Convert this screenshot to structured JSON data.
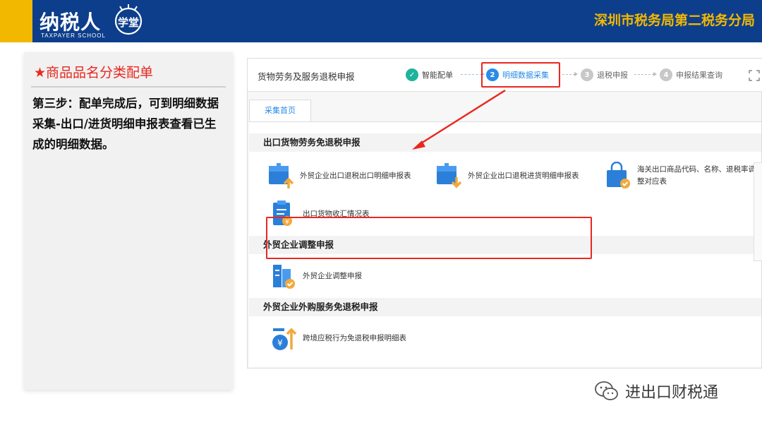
{
  "header": {
    "logo_text": "纳税人",
    "logo_subtitle": "TAXPAYER SCHOOL",
    "logo_emblem_text": "学堂",
    "office_name": "深圳市税务局第二税务分局",
    "colors": {
      "banner": "#0d3e8c",
      "accent": "#f2b800"
    }
  },
  "instruction": {
    "title": "★商品品名分类配单",
    "body": "第三步：配单完成后，可到明细数据采集-出口/进货明细申报表查看已生成的明细数据。",
    "title_color": "#e8281f"
  },
  "app": {
    "title": "货物劳务及服务退税申报",
    "steps": [
      {
        "num": "✓",
        "label": "智能配单",
        "state": "done"
      },
      {
        "num": "2",
        "label": "明细数据采集",
        "state": "active"
      },
      {
        "num": "3",
        "label": "退税申报",
        "state": "todo"
      },
      {
        "num": "4",
        "label": "申报结果查询",
        "state": "todo"
      }
    ],
    "fullscreen_icon": "fullscreen-icon",
    "tab_label": "采集首页",
    "sections": [
      {
        "title": "出口货物劳务免退税申报",
        "items": [
          {
            "label": "外贸企业出口退税出口明细申报表",
            "icon": "upload-box-icon"
          },
          {
            "label": "外贸企业出口退税进货明细申报表",
            "icon": "download-box-icon"
          },
          {
            "label": "海关出口商品代码、名称、退税率调整对应表",
            "icon": "shopping-bag-icon"
          },
          {
            "label": "出口货物收汇情况表",
            "icon": "clipboard-currency-icon"
          }
        ]
      },
      {
        "title": "外贸企业调整申报",
        "items": [
          {
            "label": "外贸企业调整申报",
            "icon": "building-check-icon"
          }
        ]
      },
      {
        "title": "外贸企业外购服务免退税申报",
        "items": [
          {
            "label": "跨境应税行为免退税申报明细表",
            "icon": "money-bag-arrow-icon"
          }
        ]
      }
    ],
    "colors": {
      "primary": "#2b8be6",
      "done": "#1fb39c",
      "highlight": "#e8281f"
    }
  },
  "watermark": {
    "text": "进出口财税通",
    "icon": "wechat-icon"
  }
}
